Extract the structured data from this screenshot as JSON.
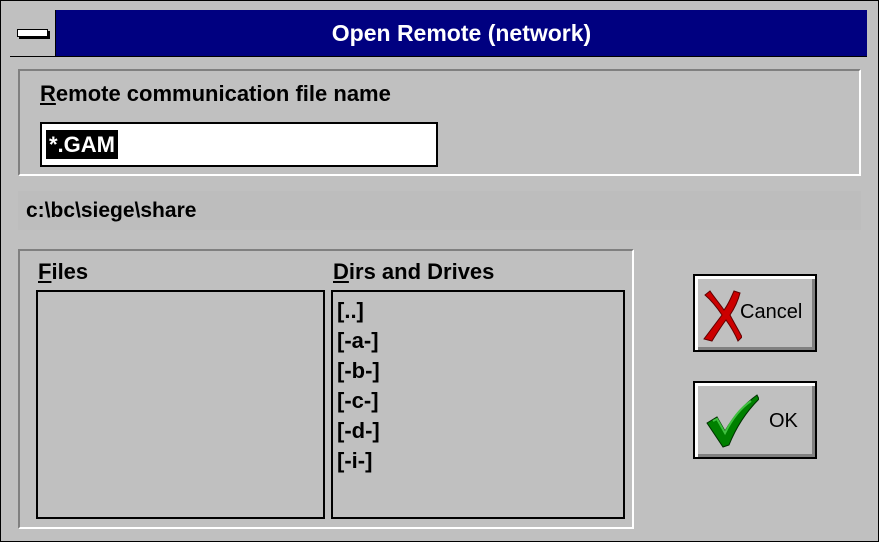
{
  "window": {
    "title": "Open Remote (network)",
    "title_bar_color": "#000080",
    "face_color": "#c0c0c0"
  },
  "filename_section": {
    "label_accel": "R",
    "label_rest": "emote communication file name",
    "input_value": "*.GAM"
  },
  "current_path": "c:\\bc\\siege\\share",
  "files": {
    "label_accel": "F",
    "label_rest": "iles",
    "items": []
  },
  "dirs": {
    "label_accel": "D",
    "label_rest": "irs and Drives",
    "items": [
      "[..]",
      "[-a-]",
      "[-b-]",
      "[-c-]",
      "[-d-]",
      "[-i-]"
    ]
  },
  "buttons": {
    "cancel": {
      "label": "Cancel",
      "icon": "red-x-icon",
      "color": "#cc0000"
    },
    "ok": {
      "label": "OK",
      "icon": "green-checkmark-icon",
      "color": "#008000"
    }
  }
}
